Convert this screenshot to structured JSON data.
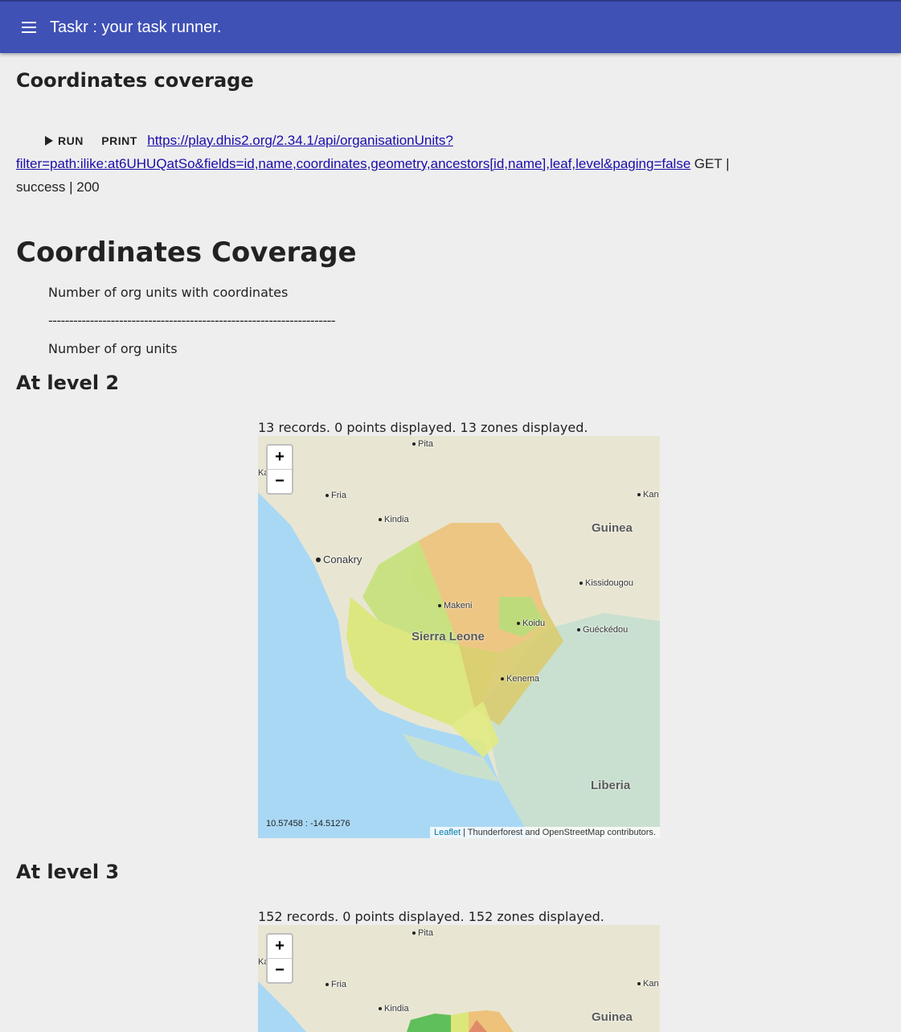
{
  "appbar": {
    "title": "Taskr : your task runner."
  },
  "section": {
    "title": "Coordinates coverage"
  },
  "task": {
    "run_label": "RUN",
    "print_label": "PRINT",
    "url": "https://play.dhis2.org/2.34.1/api/organisationUnits?filter=path:ilike:at6UHUQatSo&fields=id,name,coordinates,geometry,ancestors[id,name],leaf,level&paging=false",
    "status": "GET | success | 200"
  },
  "report": {
    "title": "Coordinates Coverage",
    "numerator": "Number of org units with coordinates",
    "separator": "---------------------------------------------------------------------",
    "denominator": "Number of org units"
  },
  "levels": [
    {
      "heading": "At level 2",
      "summary": "13 records. 0 points displayed. 13 zones displayed.",
      "coords": "10.57458 : -14.51276"
    },
    {
      "heading": "At level 3",
      "summary": "152 records. 0 points displayed. 152 zones displayed."
    }
  ],
  "map": {
    "zoom_in": "+",
    "zoom_out": "−",
    "attribution_link": "Leaflet",
    "attribution_text": " | Thunderforest and OpenStreetMap contributors.",
    "places": {
      "pita": "Pita",
      "ka": "Ka",
      "fria": "Fria",
      "kan": "Kan",
      "kindia": "Kindia",
      "conakry": "Conakry",
      "kissidougou": "Kissidougou",
      "makeni": "Makeni",
      "koidu": "Koidu",
      "gueckedou": "Guéckédou",
      "kenema": "Kenema"
    },
    "countries": {
      "guinea": "Guinea",
      "sierra_leone": "Sierra Leone",
      "liberia": "Liberia"
    },
    "colors": {
      "sea": "#a9d8f5",
      "land": "#e8e6d2",
      "liberia": "#c9e0d0"
    }
  }
}
